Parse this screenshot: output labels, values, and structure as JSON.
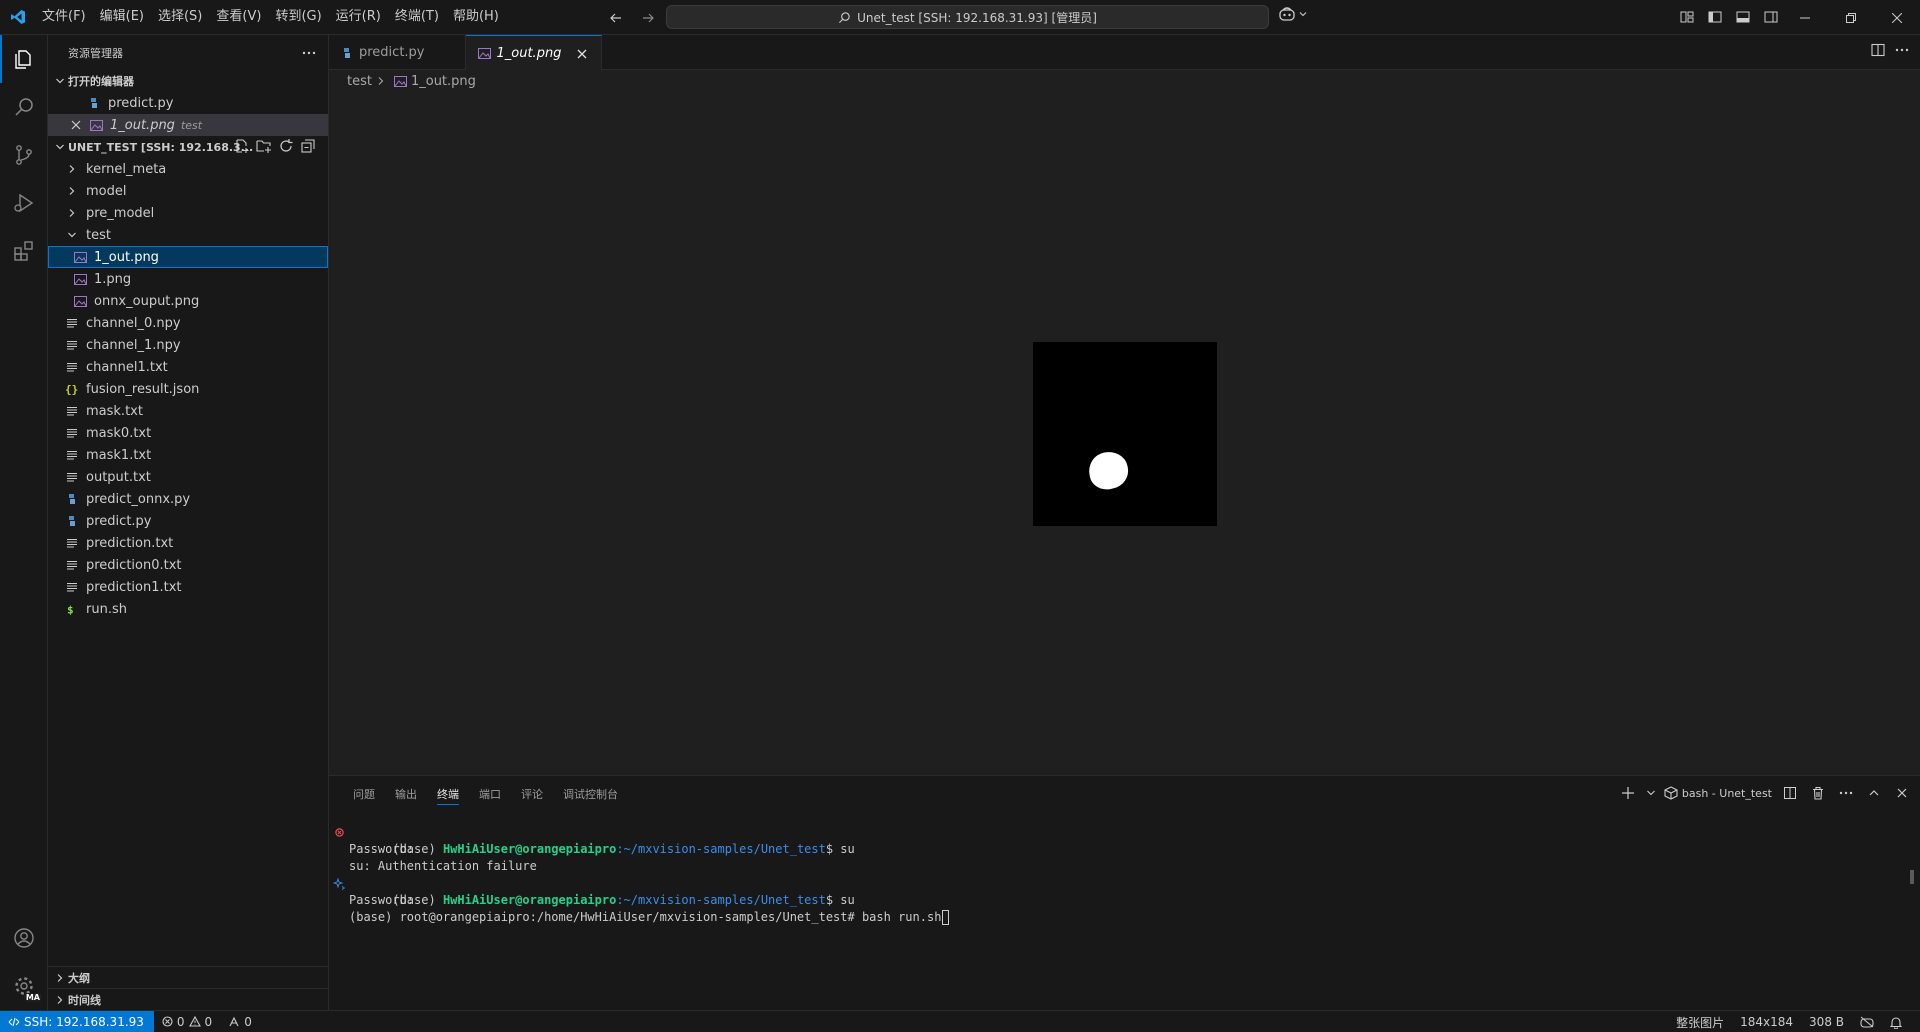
{
  "titlebar": {
    "menus": [
      "文件(F)",
      "编辑(E)",
      "选择(S)",
      "查看(V)",
      "转到(G)",
      "运行(R)",
      "终端(T)",
      "帮助(H)"
    ],
    "search_text": "Unet_test [SSH: 192.168.31.93] [管理员]"
  },
  "sidebar": {
    "title": "资源管理器",
    "open_editors_label": "打开的编辑器",
    "open_editors": [
      {
        "name": "predict.py",
        "desc": ""
      },
      {
        "name": "1_out.png",
        "desc": "test"
      }
    ],
    "workspace_label": "UNET_TEST [SSH: 192.168.3...",
    "folders": [
      {
        "name": "kernel_meta"
      },
      {
        "name": "model"
      },
      {
        "name": "pre_model"
      },
      {
        "name": "test"
      }
    ],
    "test_children": [
      "1_out.png",
      "1.png",
      "onnx_ouput.png"
    ],
    "files": [
      {
        "name": "channel_0.npy",
        "icon": "text-file-icon"
      },
      {
        "name": "channel_1.npy",
        "icon": "text-file-icon"
      },
      {
        "name": "channel1.txt",
        "icon": "text-file-icon"
      },
      {
        "name": "fusion_result.json",
        "icon": "json-file-icon"
      },
      {
        "name": "mask.txt",
        "icon": "text-file-icon"
      },
      {
        "name": "mask0.txt",
        "icon": "text-file-icon"
      },
      {
        "name": "mask1.txt",
        "icon": "text-file-icon"
      },
      {
        "name": "output.txt",
        "icon": "text-file-icon"
      },
      {
        "name": "predict_onnx.py",
        "icon": "python-file-icon"
      },
      {
        "name": "predict.py",
        "icon": "python-file-icon"
      },
      {
        "name": "prediction.txt",
        "icon": "text-file-icon"
      },
      {
        "name": "prediction0.txt",
        "icon": "text-file-icon"
      },
      {
        "name": "prediction1.txt",
        "icon": "text-file-icon"
      },
      {
        "name": "run.sh",
        "icon": "shell-file-icon"
      }
    ],
    "outline_label": "大纲",
    "timeline_label": "时间线"
  },
  "editor": {
    "tabs": [
      {
        "label": "predict.py",
        "active": false
      },
      {
        "label": "1_out.png",
        "active": true
      }
    ],
    "breadcrumb": [
      "test",
      "1_out.png"
    ]
  },
  "panel": {
    "tabs": [
      "问题",
      "输出",
      "终端",
      "端口",
      "评论",
      "调试控制台"
    ],
    "active_tab": "终端",
    "terminal_name": "bash - Unet_test",
    "lines": {
      "l1_base": "(base) ",
      "l1_user": "HwHiAiUser@orangepiaipro",
      "l1_path": ":~/mxvision-samples/Unet_test",
      "l1_cmd": "$ su",
      "l2": "Password:",
      "l3": "su: Authentication failure",
      "l4_base": "(base) ",
      "l4_user": "HwHiAiUser@orangepiaipro",
      "l4_path": ":~/mxvision-samples/Unet_test",
      "l4_cmd": "$ su",
      "l5": "Password:",
      "l6": "(base) root@orangepiaipro:/home/HwHiAiUser/mxvision-samples/Unet_test# bash run.sh"
    }
  },
  "statusbar": {
    "remote": "SSH: 192.168.31.93",
    "errors": "0",
    "warnings": "0",
    "ports": "0",
    "image_mode": "整张图片",
    "dimensions": "184x184",
    "size": "308 B"
  },
  "colors": {
    "accent": "#0078d4",
    "selection": "#04395e",
    "terminal_user": "#23d18b",
    "terminal_path": "#3b8eea",
    "error": "#f14c4c"
  }
}
